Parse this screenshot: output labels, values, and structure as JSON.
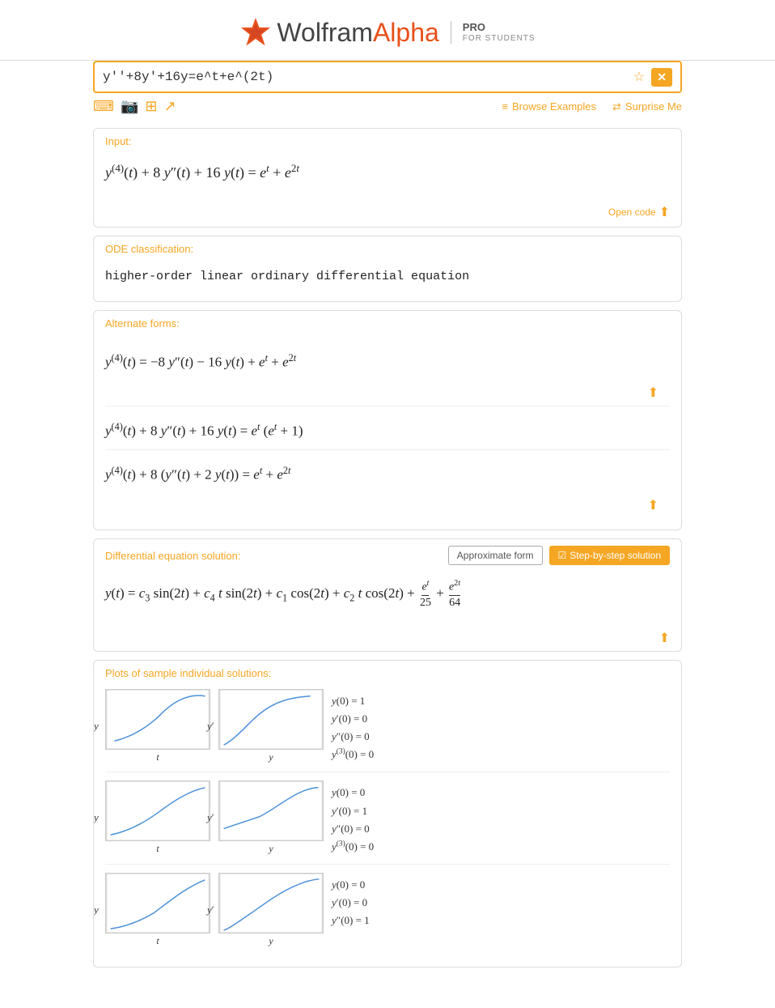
{
  "logo": {
    "wolfram": "Wolfram",
    "alpha": "Alpha",
    "pro": "PRO",
    "for_students": "FOR STUDENTS"
  },
  "search": {
    "value": "y''+8y'+16y=e^t+e^(2t)",
    "placeholder": "Enter a query"
  },
  "toolbar": {
    "browse_examples": "Browse Examples",
    "surprise_me": "Surprise Me"
  },
  "pods": {
    "input": {
      "title": "Input:",
      "open_code": "Open code"
    },
    "ode_classification": {
      "title": "ODE classification:",
      "value": "higher-order linear ordinary differential equation"
    },
    "alternate_forms": {
      "title": "Alternate forms:"
    },
    "solution": {
      "title": "Differential equation solution:",
      "btn_approx": "Approximate form",
      "btn_stepbystep": "Step-by-step solution"
    },
    "plots": {
      "title": "Plots of sample individual solutions:",
      "rows": [
        {
          "conditions": [
            "y(0) = 1",
            "y′(0) = 0",
            "y″(0) = 0",
            "y⁽³⁾(0) = 0"
          ]
        },
        {
          "conditions": [
            "y(0) = 0",
            "y′(0) = 1",
            "y″(0) = 0",
            "y⁽³⁾(0) = 0"
          ]
        },
        {
          "conditions": [
            "y(0) = 0",
            "y′(0) = 0",
            "y″(0) = 1"
          ]
        }
      ]
    }
  }
}
